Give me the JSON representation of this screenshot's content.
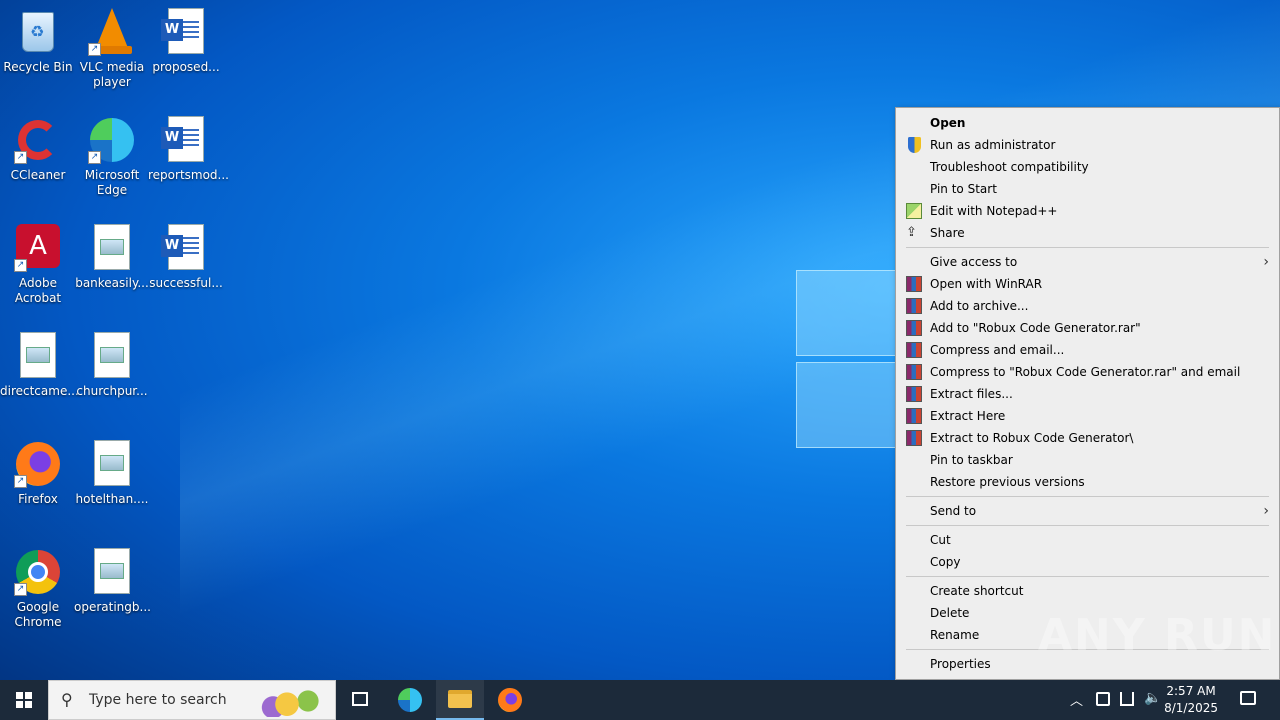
{
  "desktop": {
    "icons": [
      {
        "label": "Recycle Bin"
      },
      {
        "label": "VLC media player"
      },
      {
        "label": "proposed..."
      },
      {
        "label": "CCleaner"
      },
      {
        "label": "Microsoft Edge"
      },
      {
        "label": "reportsmod..."
      },
      {
        "label": "Adobe Acrobat"
      },
      {
        "label": "bankeasily..."
      },
      {
        "label": "successful..."
      },
      {
        "label": "directcame..."
      },
      {
        "label": "churchpur..."
      },
      {
        "label": "Firefox"
      },
      {
        "label": "hotelthan...."
      },
      {
        "label": "Google Chrome"
      },
      {
        "label": "operatingb..."
      }
    ]
  },
  "context_menu": {
    "items": [
      {
        "label": "Open"
      },
      {
        "label": "Run as administrator",
        "icon": "shield-icon"
      },
      {
        "label": "Troubleshoot compatibility"
      },
      {
        "label": "Pin to Start"
      },
      {
        "label": "Edit with Notepad++",
        "icon": "notepadpp-icon"
      },
      {
        "label": "Share",
        "icon": "share-icon"
      },
      {
        "label": "Give access to"
      },
      {
        "label": "Open with WinRAR",
        "icon": "winrar-icon"
      },
      {
        "label": "Add to archive...",
        "icon": "winrar-icon"
      },
      {
        "label": "Add to \"Robux Code Generator.rar\"",
        "icon": "winrar-icon"
      },
      {
        "label": "Compress and email...",
        "icon": "winrar-icon"
      },
      {
        "label": "Compress to \"Robux Code Generator.rar\" and email",
        "icon": "winrar-icon"
      },
      {
        "label": "Extract files...",
        "icon": "winrar-icon"
      },
      {
        "label": "Extract Here",
        "icon": "winrar-icon"
      },
      {
        "label": "Extract to Robux Code Generator\\",
        "icon": "winrar-icon"
      },
      {
        "label": "Pin to taskbar"
      },
      {
        "label": "Restore previous versions"
      },
      {
        "label": "Send to"
      },
      {
        "label": "Cut"
      },
      {
        "label": "Copy"
      },
      {
        "label": "Create shortcut"
      },
      {
        "label": "Delete"
      },
      {
        "label": "Rename"
      },
      {
        "label": "Properties"
      }
    ]
  },
  "taskbar": {
    "search_placeholder": "Type here to search",
    "time": "2:57 AM",
    "date": "8/1/2025"
  },
  "watermark": "ANY RUN"
}
